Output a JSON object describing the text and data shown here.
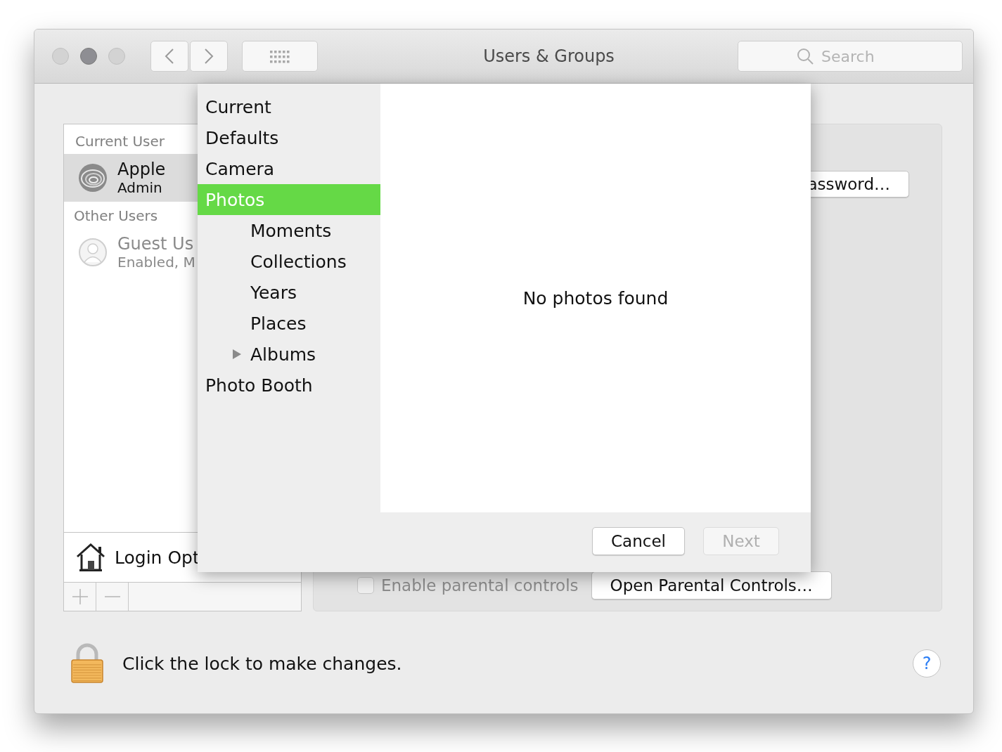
{
  "window": {
    "title": "Users & Groups",
    "search": {
      "placeholder": "Search"
    }
  },
  "users": {
    "current_header": "Current User",
    "current": {
      "name": "Apple",
      "role": "Admin",
      "selected": true
    },
    "other_header": "Other Users",
    "others": [
      {
        "name": "Guest Us",
        "role": "Enabled, M",
        "selected": false
      }
    ],
    "login_options": "Login Opt"
  },
  "details": {
    "password_button": "assword…",
    "parental_checkbox": {
      "label": "Enable parental controls",
      "checked": false,
      "disabled": true
    },
    "parental_button": "Open Parental Controls…"
  },
  "picker": {
    "sources": [
      {
        "label": "Current",
        "selected": false
      },
      {
        "label": "Defaults",
        "selected": false
      },
      {
        "label": "Camera",
        "selected": false
      },
      {
        "label": "Photos",
        "selected": true,
        "children": [
          {
            "label": "Moments",
            "selected": false
          },
          {
            "label": "Collections",
            "selected": false
          },
          {
            "label": "Years",
            "selected": false
          },
          {
            "label": "Places",
            "selected": false
          },
          {
            "label": "Albums",
            "selected": false,
            "expanded": false
          }
        ]
      },
      {
        "label": "Photo Booth",
        "selected": false
      }
    ],
    "empty_message": "No photos found",
    "buttons": [
      {
        "label": "Cancel",
        "disabled": false
      },
      {
        "label": "Next",
        "disabled": true
      }
    ]
  },
  "footer": {
    "lock_text": "Click the lock to make changes.",
    "help": "?"
  }
}
